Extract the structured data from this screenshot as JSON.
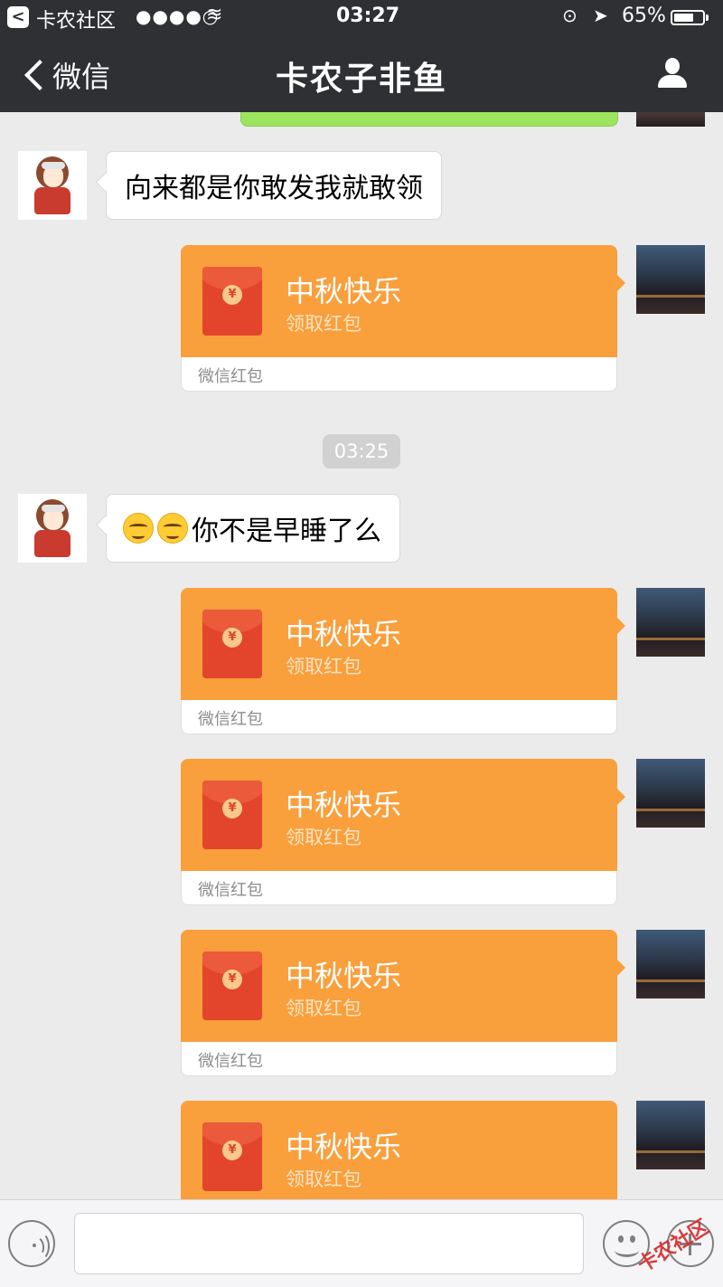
{
  "status_bar": {
    "back_glyph": "<",
    "carrier": "卡农社区",
    "signal": "●●●●○",
    "wifi_icon": "≋",
    "time": "03:27",
    "lock_icon": "⊙",
    "location_icon": "➤",
    "battery": "65%",
    "battery_level": 0.65
  },
  "nav": {
    "back_label": "微信",
    "title": "卡农子非鱼",
    "profile_icon": "person-icon"
  },
  "messages": [
    {
      "sender": "contact",
      "type": "text",
      "text": "向来都是你敢发我就敢领"
    },
    {
      "sender": "me",
      "type": "red_packet",
      "greeting": "中秋快乐",
      "action": "领取红包",
      "source": "微信红包",
      "coin": "¥"
    },
    {
      "type": "timestamp",
      "text": "03:25"
    },
    {
      "sender": "contact",
      "type": "text",
      "emoji": [
        "smirk-emoji",
        "smirk-emoji"
      ],
      "text": "你不是早睡了么"
    },
    {
      "sender": "me",
      "type": "red_packet",
      "greeting": "中秋快乐",
      "action": "领取红包",
      "source": "微信红包",
      "coin": "¥"
    },
    {
      "sender": "me",
      "type": "red_packet",
      "greeting": "中秋快乐",
      "action": "领取红包",
      "source": "微信红包",
      "coin": "¥"
    },
    {
      "sender": "me",
      "type": "red_packet",
      "greeting": "中秋快乐",
      "action": "领取红包",
      "source": "微信红包",
      "coin": "¥"
    },
    {
      "sender": "me",
      "type": "red_packet",
      "greeting": "中秋快乐",
      "action": "领取红包",
      "coin": "¥"
    }
  ],
  "input_bar": {
    "voice_icon": "voice-icon",
    "emoji_icon": "emoji-icon",
    "plus_icon": "plus-icon"
  },
  "watermark": "卡农社区",
  "colors": {
    "nav_bg": "#2e3033",
    "chat_bg": "#ebebeb",
    "red_packet": "#f99f3c",
    "envelope": "#e2452b",
    "sent_bubble": "#9ce45e"
  }
}
